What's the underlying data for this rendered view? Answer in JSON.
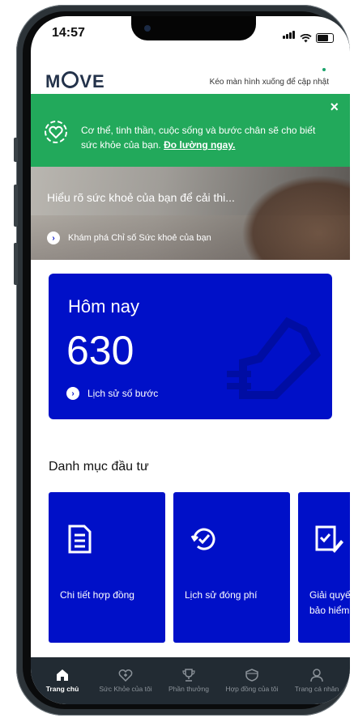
{
  "status_bar": {
    "time": "14:57"
  },
  "header": {
    "logo": "MOVE",
    "pull_hint": "Kéo màn hình xuống để cập nhật"
  },
  "banner": {
    "text": "Cơ thể, tinh thần, cuộc sống và bước chân sẽ cho biết sức khỏe của bạn.",
    "link": "Đo lường ngay.",
    "close": "×"
  },
  "hero": {
    "title": "Hiểu rõ sức khoẻ của bạn để cải thi...",
    "link": "Khám phá Chỉ số Sức khoẻ của bạn"
  },
  "today": {
    "label": "Hôm nay",
    "steps": "630",
    "link": "Lịch sử số bước"
  },
  "portfolio": {
    "title": "Danh mục đầu tư",
    "cards": [
      {
        "label": "Chi tiết hợp đồng",
        "icon": "document-icon"
      },
      {
        "label": "Lịch sử đóng phí",
        "icon": "history-check-icon"
      },
      {
        "label": "Giải quyết",
        "label2": "bảo hiểm",
        "icon": "claim-edit-icon"
      }
    ]
  },
  "tabbar": {
    "items": [
      {
        "label": "Trang chủ",
        "icon": "home-icon",
        "active": true
      },
      {
        "label": "Sức Khỏe của tôi",
        "icon": "heart-icon"
      },
      {
        "label": "Phần thưởng",
        "icon": "trophy-icon"
      },
      {
        "label": "Hợp đồng của tôi",
        "icon": "shield-icon"
      },
      {
        "label": "Trang cá nhân",
        "icon": "person-icon"
      }
    ]
  },
  "colors": {
    "brand_blue": "#0010c8",
    "banner_green": "#22a95b",
    "tabbar": "#222b33"
  }
}
